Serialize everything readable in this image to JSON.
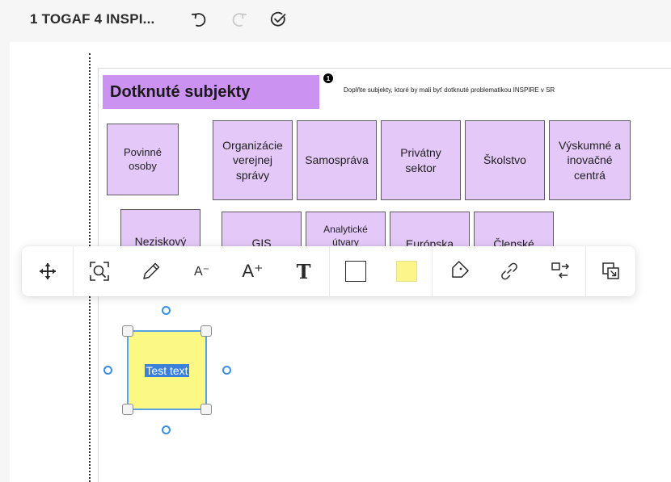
{
  "header": {
    "board_title": "1 TOGAF 4 INSPI...",
    "undo_icon": "undo-icon",
    "redo_icon": "redo-icon",
    "saved_icon": "check-circle-icon"
  },
  "frame": {
    "title": "Dotknuté subjekty",
    "badge": "1",
    "hint": "Doplňte subjekty, ktoré by mali byť dotknuté problematikou INSPIRE v SR"
  },
  "stickies": {
    "row1": [
      {
        "lines": [
          "Povinné",
          "osoby"
        ]
      },
      {
        "lines": [
          "Organizácie",
          "verejnej",
          "správy"
        ]
      },
      {
        "lines": [
          "Samospráva"
        ]
      },
      {
        "lines": [
          "Privátny",
          "sektor"
        ]
      },
      {
        "lines": [
          "Školstvo"
        ]
      },
      {
        "lines": [
          "Výskumné a",
          "inovačné",
          "centrá"
        ]
      }
    ],
    "row2": [
      {
        "lines": [
          "Neziskový"
        ]
      },
      {
        "lines": [
          "GIS"
        ]
      },
      {
        "lines": [
          "Analytické",
          "útvary"
        ]
      },
      {
        "lines": [
          "Európska"
        ]
      },
      {
        "lines": [
          "Členské"
        ]
      }
    ]
  },
  "toolbar": {
    "move_icon": "move-icon",
    "zoom_icon": "zoom-fit-icon",
    "pen_icon": "pencil-icon",
    "font_decrease": "A⁻",
    "font_increase": "A⁺",
    "text_style": "T",
    "shape_icon": "square-outline-icon",
    "color_swatch": "#fbf58a",
    "tag_icon": "tag-icon",
    "link_icon": "link-icon",
    "swap_icon": "swap-icon",
    "resize_icon": "resize-icon"
  },
  "selected_sticky": {
    "text": "Test text",
    "fill": "#fbf983",
    "border": "#5aa2e6"
  },
  "colors": {
    "sticky_purple": "#e4c8f8",
    "title_purple": "#cc92f2",
    "selection_blue": "#3a7fd8"
  }
}
